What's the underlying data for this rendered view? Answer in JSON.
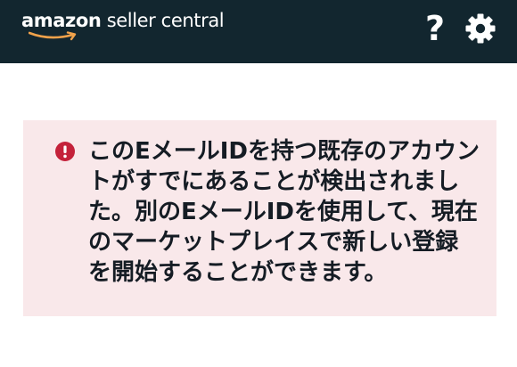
{
  "header": {
    "logo": {
      "brand": "amazon",
      "product": " seller central"
    },
    "icons": {
      "help": "help-icon",
      "settings": "gear-icon"
    },
    "help_glyph": "?",
    "colors": {
      "header_bg": "#12262f",
      "smile": "#f0a24b"
    }
  },
  "alert": {
    "type": "error",
    "icon": "error-icon",
    "message": "このEメールIDを持つ既存のアカウントがすでにあることが検出されました。別のEメールIDを使用して、現在のマーケットプレイスで新しい登録を開始することができます。",
    "colors": {
      "background": "#f9e8ea",
      "icon": "#c4213a",
      "text": "#151c24"
    }
  }
}
